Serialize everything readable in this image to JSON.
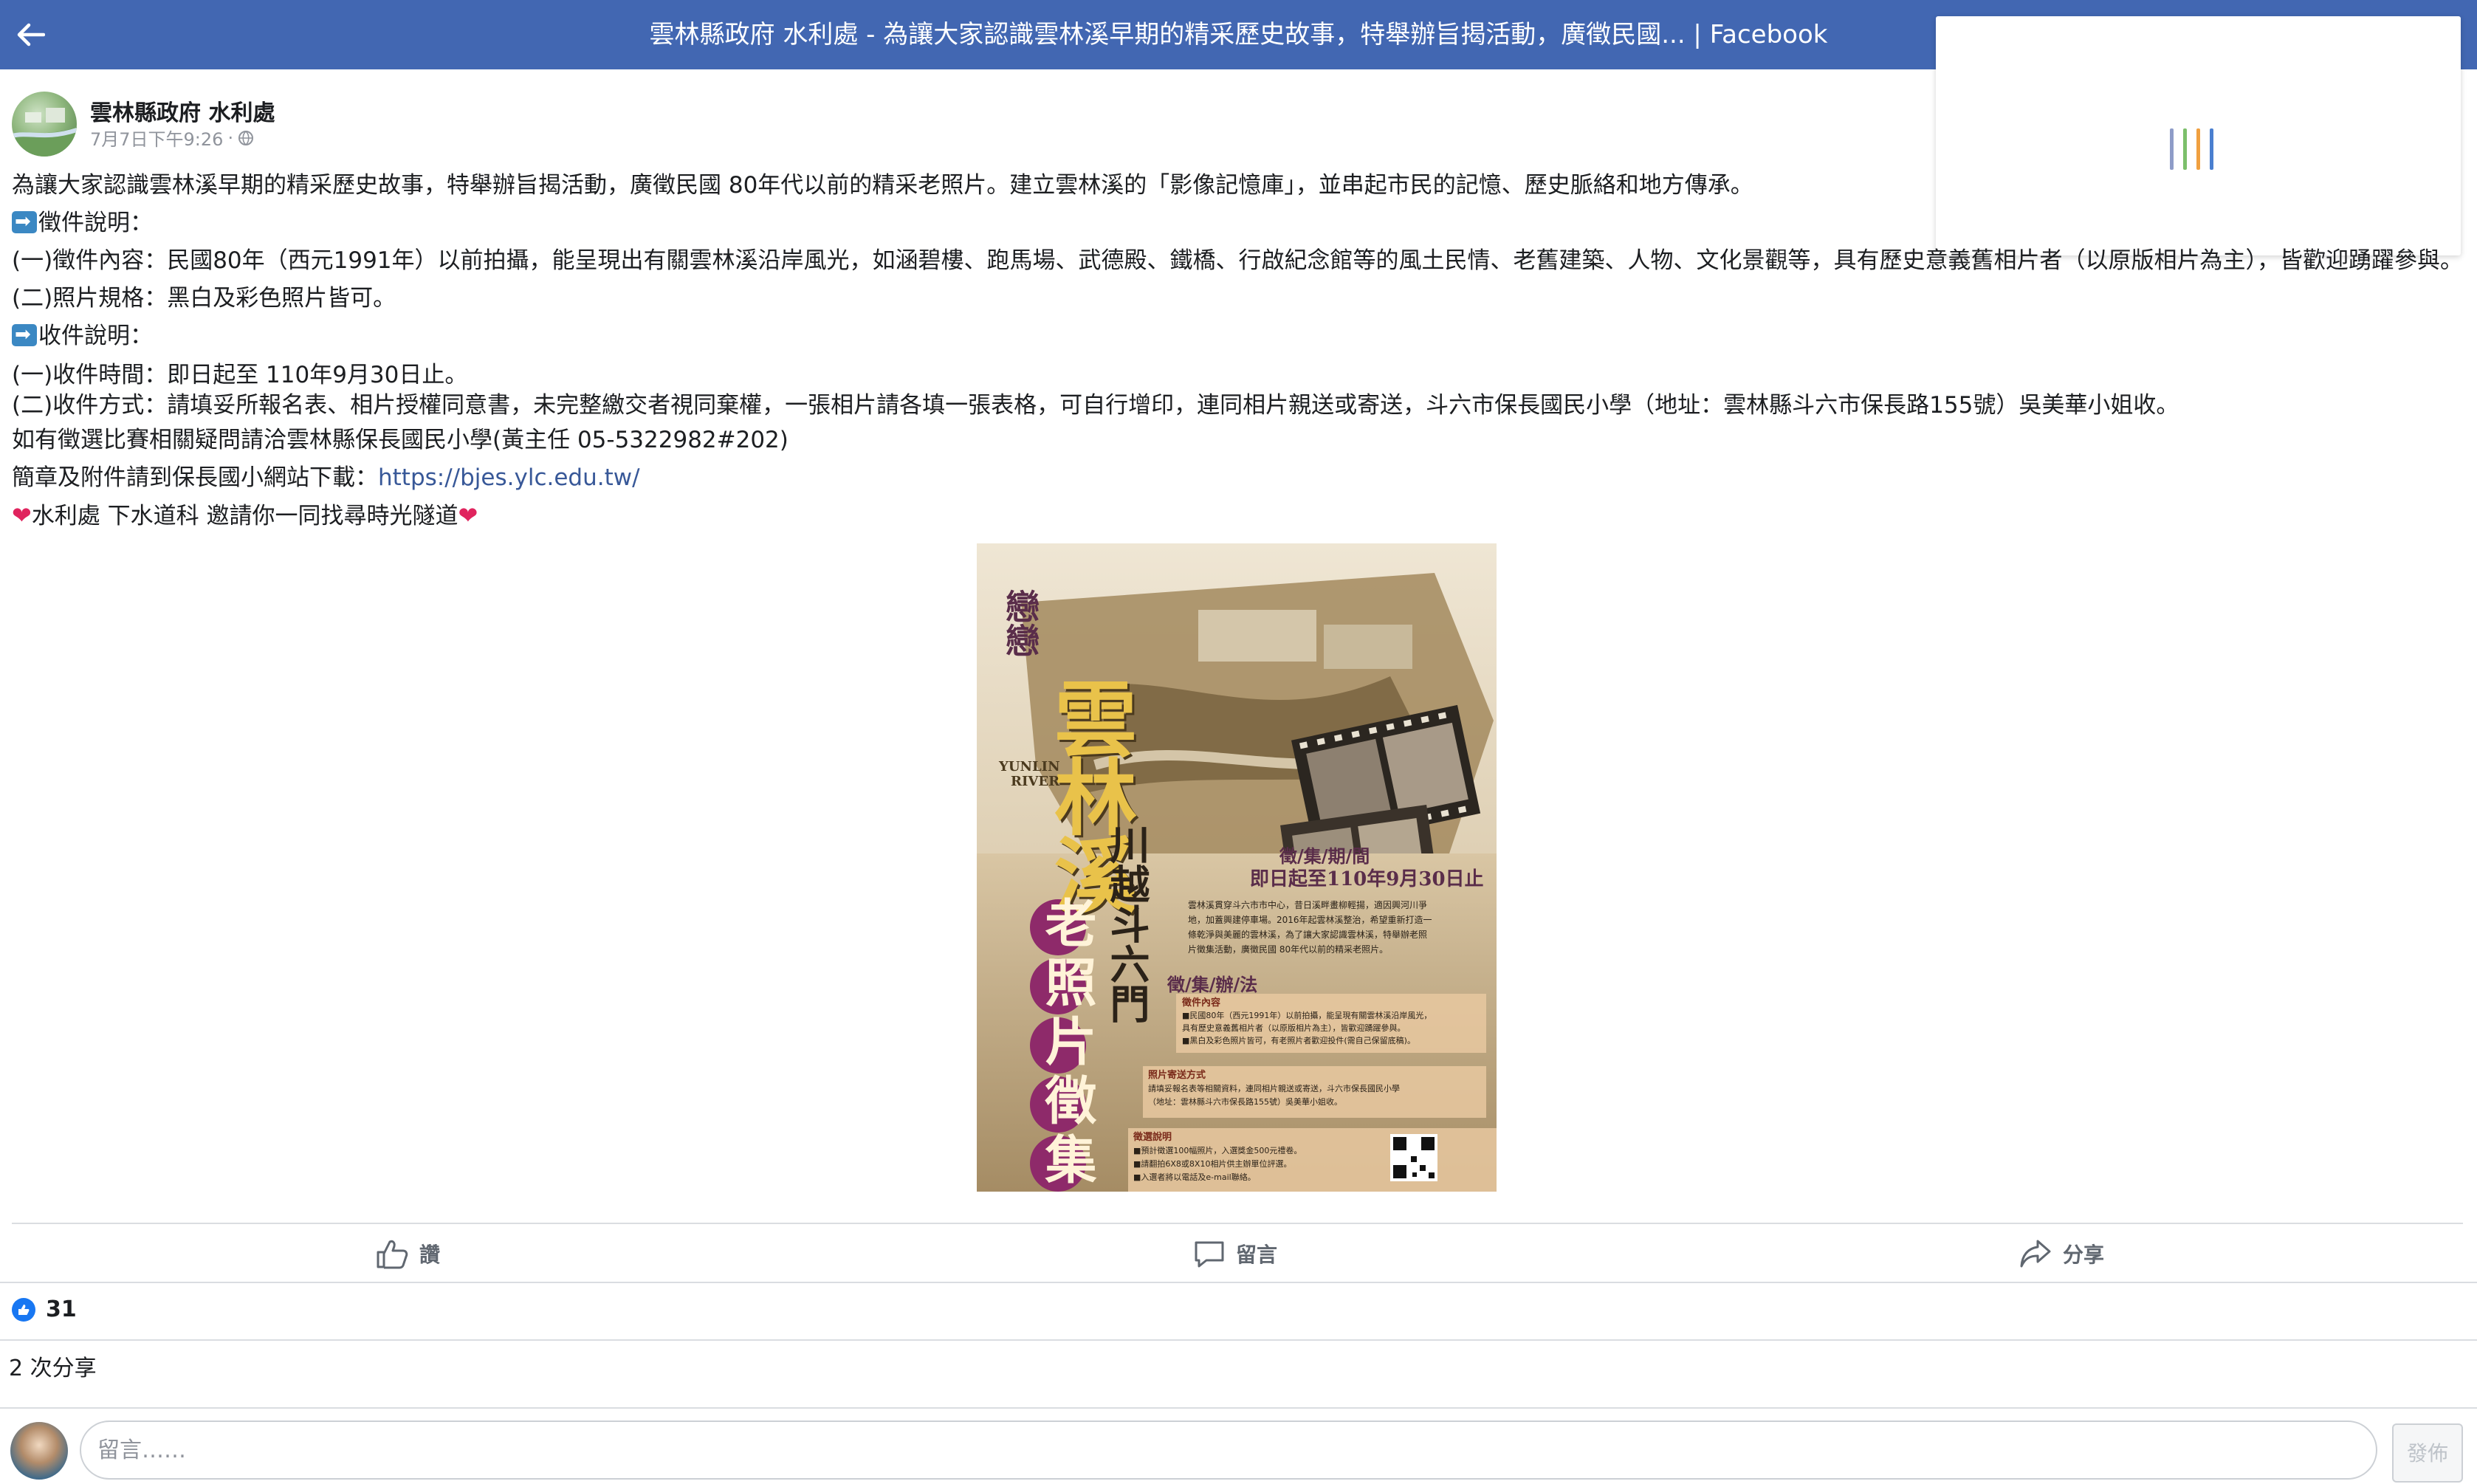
{
  "topbar": {
    "title": "雲林縣政府 水利處 - 為讓大家認識雲林溪早期的精采歷史故事，特舉辦旨揭活動，廣徵民國... | Facebook"
  },
  "post": {
    "author": "雲林縣政府 水利處",
    "timestamp": "7月7日下午9:26",
    "separator": "·",
    "audience_icon": "globe-icon",
    "lines": [
      {
        "text": "為讓大家認識雲林溪早期的精采歷史故事，特舉辦旨揭活動，廣徵民國 80年代以前的精采老照片。建立雲林溪的「影像記憶庫」，並串起市民的記憶、歷史脈絡和地方傳承。"
      },
      {
        "emoji": "arrow-right-emoji",
        "text": "徵件說明："
      },
      {
        "text": "(一)徵件內容：民國80年（西元1991年）以前拍攝，能呈現出有關雲林溪沿岸風光，如涵碧樓、跑馬場、武德殿、鐵橋、行啟紀念館等的風土民情、老舊建築、人物、文化景觀等，具有歷史意義舊相片者（以原版相片為主），皆歡迎踴躍參與。"
      },
      {
        "text": "(二)照片規格：黑白及彩色照片皆可。"
      },
      {
        "emoji": "arrow-right-emoji",
        "text": "收件說明："
      },
      {
        "text": "(一)收件時間：即日起至 110年9月30日止。"
      },
      {
        "text": "(二)收件方式：請填妥所報名表、相片授權同意書，未完整繳交者視同棄權，一張相片請各填一張表格，可自行增印，連同相片親送或寄送，斗六市保長國民小學（地址：雲林縣斗六市保長路155號）吳美華小姐收。"
      },
      {
        "text": "如有徵選比賽相關疑問請洽雲林縣保長國民小學(黃主任 05-5322982#202)"
      },
      {
        "text": "簡章及附件請到保長國小網站下載：",
        "link": "https://bjes.ylc.edu.tw/"
      },
      {
        "heart_left": "❤",
        "text": "水利處 下水道科 邀請你一同找尋時光隧道",
        "heart_right": "❤"
      }
    ]
  },
  "poster": {
    "title_vertical_1": "戀戀",
    "title_main": "雲林溪",
    "subtitle_en_1": "YUNLIN",
    "subtitle_en_2": "RIVER",
    "subtitle_vertical": "川越斗六門",
    "title_bottom": "老照片徵集",
    "period_label": "徵/集/期/間",
    "period_value": "即日起至110年9月30日止",
    "intro_lines": [
      "雲林溪貫穿斗六市市中心，昔日溪畔畫柳輕揚，適因興河川爭",
      "地，加蓋興建停車場。2016年起雲林溪整治，希望重新打造一",
      "條乾淨與美麗的雲林溪，為了讓大家認識雲林溪，特舉辦老照",
      "片徵集活動，廣徵民國 80年代以前的精采老照片。"
    ],
    "method_label": "徵/集/辦/法",
    "box1_title": "徵件內容",
    "box1_lines": [
      "■民國80年（西元1991年）以前拍攝，能呈現有關雲林溪沿岸風光，",
      "具有歷史意義舊相片者（以原版相片為主），皆歡迎踴躍參與。",
      "■黑白及彩色照片皆可，有老照片者歡迎投件(需自己保留底稿)。"
    ],
    "box2_title": "照片寄送方式",
    "box2_lines": [
      "請填妥報名表等相關資料，連同相片親送或寄送，斗六市保長國民小學",
      "（地址：雲林縣斗六市保長路155號）吳美華小姐收。"
    ],
    "box3_title": "徵選說明",
    "box3_lines": [
      "■預計徵選100幅照片，入選獎金500元禮卷。",
      "■請翻拍6X8或8X10相片供主辦單位評選。",
      "■入選者將以電話及e-mail聯絡。"
    ]
  },
  "actions": {
    "like_label": "讚",
    "comment_label": "留言",
    "share_label": "分享"
  },
  "stats": {
    "likes": "31",
    "shares": "2 次分享"
  },
  "comment": {
    "placeholder": "留言……",
    "post_label": "發佈"
  },
  "colors": {
    "topbar": "#4267b2",
    "link": "#385898",
    "like_blue": "#1877f2",
    "heart": "#e0245e"
  }
}
